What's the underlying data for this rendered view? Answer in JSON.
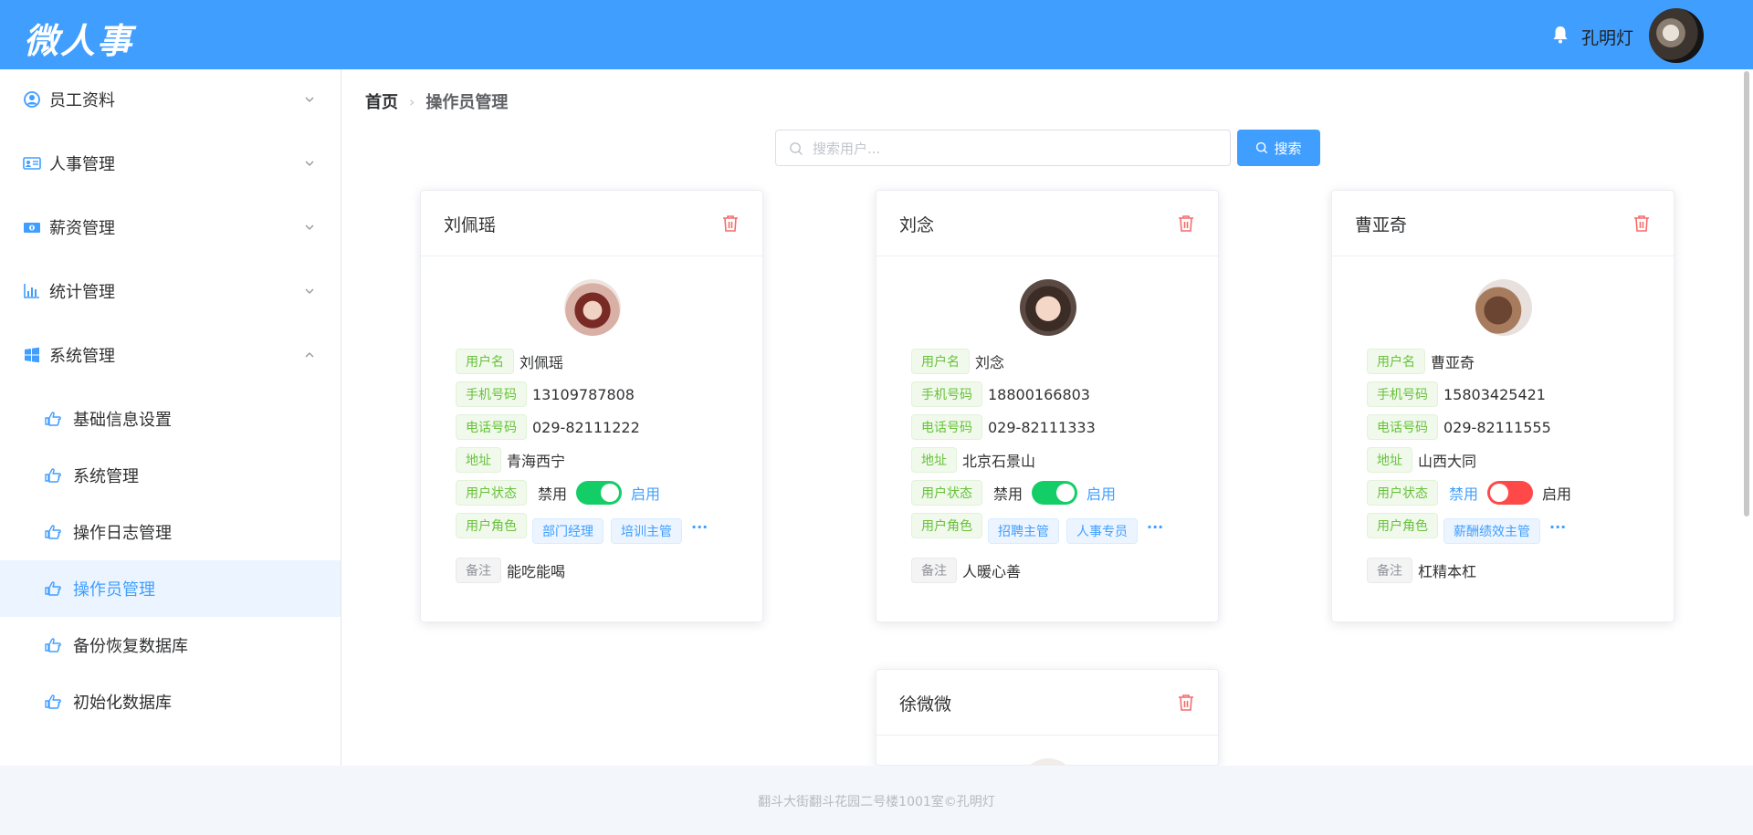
{
  "header": {
    "logo": "微人事",
    "username": "孔明灯"
  },
  "sidebar": {
    "menus": [
      {
        "label": "员工资料",
        "icon": "user-circle-icon",
        "expanded": false
      },
      {
        "label": "人事管理",
        "icon": "id-card-icon",
        "expanded": false
      },
      {
        "label": "薪资管理",
        "icon": "money-icon",
        "expanded": false
      },
      {
        "label": "统计管理",
        "icon": "bar-chart-icon",
        "expanded": false
      },
      {
        "label": "系统管理",
        "icon": "windows-icon",
        "expanded": true
      }
    ],
    "sub_items": [
      {
        "label": "基础信息设置",
        "active": false
      },
      {
        "label": "系统管理",
        "active": false
      },
      {
        "label": "操作日志管理",
        "active": false
      },
      {
        "label": "操作员管理",
        "active": true
      },
      {
        "label": "备份恢复数据库",
        "active": false
      },
      {
        "label": "初始化数据库",
        "active": false
      }
    ]
  },
  "breadcrumb": {
    "home": "首页",
    "current": "操作员管理"
  },
  "search": {
    "placeholder": "搜索用户...",
    "value": "",
    "button_label": "搜索"
  },
  "card_labels": {
    "username": "用户名",
    "phone": "手机号码",
    "telephone": "电话号码",
    "address": "地址",
    "status": "用户状态",
    "roles": "用户角色",
    "remark": "备注",
    "disabled": "禁用",
    "enabled": "启用",
    "more": "···"
  },
  "users": [
    {
      "name": "刘佩瑶",
      "username": "刘佩瑶",
      "phone": "13109787808",
      "telephone": "029-82111222",
      "address": "青海西宁",
      "enabled": true,
      "roles": [
        "部门经理",
        "培训主管"
      ],
      "remark": "能吃能喝"
    },
    {
      "name": "刘念",
      "username": "刘念",
      "phone": "18800166803",
      "telephone": "029-82111333",
      "address": "北京石景山",
      "enabled": true,
      "roles": [
        "招聘主管",
        "人事专员"
      ],
      "remark": "人暖心善"
    },
    {
      "name": "曹亚奇",
      "username": "曹亚奇",
      "phone": "15803425421",
      "telephone": "029-82111555",
      "address": "山西大同",
      "enabled": false,
      "roles": [
        "薪酬绩效主管"
      ],
      "remark": "杠精本杠"
    },
    {
      "name": "徐微微"
    }
  ],
  "footer": {
    "text": "翻斗大街翻斗花园二号楼1001室©孔明灯"
  },
  "colors": {
    "primary": "#409eff",
    "switch_on": "#13ce66",
    "switch_off": "#ff4949",
    "danger": "#f56c6c"
  }
}
